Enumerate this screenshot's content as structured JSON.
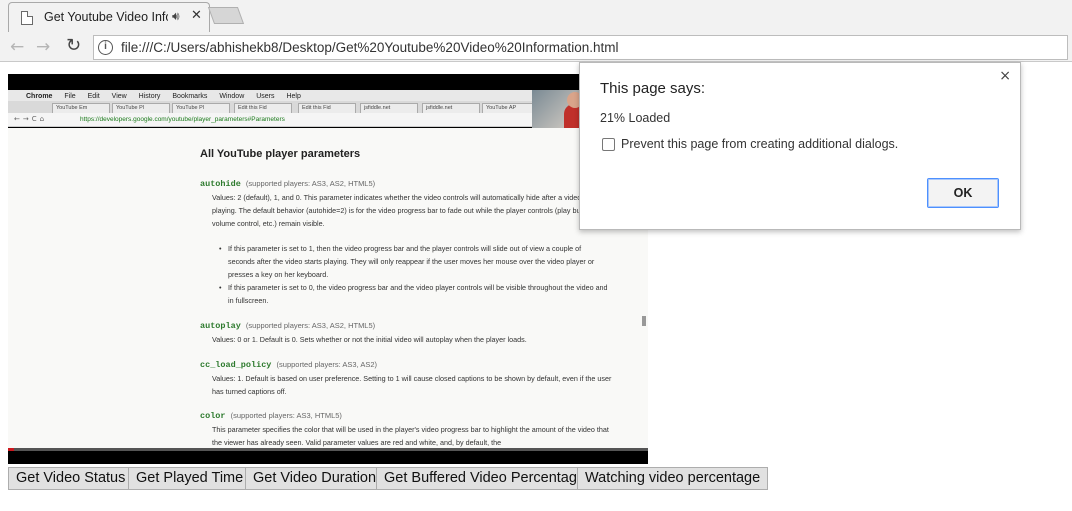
{
  "browser": {
    "tab_title": "Get Youtube Video Information",
    "tab_audio_icon": "speaker-icon",
    "url": "file:///C:/Users/abhishekb8/Desktop/Get%20Youtube%20Video%20Information.html"
  },
  "video": {
    "menubar": [
      "Chrome",
      "File",
      "Edit",
      "View",
      "History",
      "Bookmarks",
      "Window",
      "Users",
      "Help"
    ],
    "tabs": [
      "YouTube Em",
      "YouTube Pl",
      "YouTube Pl",
      "Edit this Fid",
      "Edit this Fid",
      "jsfiddle.net",
      "jsfiddle.net",
      "YouTube AP"
    ],
    "address": "https://developers.google.com/youtube/player_parameters#Parameters",
    "heading": "All YouTube player parameters",
    "params": [
      {
        "name": "autohide",
        "supported": "(supported players: AS3, AS2, HTML5)",
        "text": "Values: 2 (default), 1, and 0. This parameter indicates whether the video controls will automatically hide after a video begins playing. The default behavior (autohide=2) is for the video progress bar to fade out while the player controls (play button, volume control, etc.) remain visible."
      },
      {
        "name": "autoplay",
        "supported": "(supported players: AS3, AS2, HTML5)",
        "text": "Values: 0 or 1. Default is 0. Sets whether or not the initial video will autoplay when the player loads."
      },
      {
        "name": "cc_load_policy",
        "supported": "(supported players: AS3, AS2)",
        "text": "Values: 1. Default is based on user preference. Setting to 1 will cause closed captions to be shown by default, even if the user has turned captions off."
      },
      {
        "name": "color",
        "supported": "(supported players: AS3, HTML5)",
        "text": "This parameter specifies the color that will be used in the player's video progress bar to highlight the amount of the video that the viewer has already seen. Valid parameter values are red and white, and, by default, the"
      }
    ],
    "bullets": [
      "If this parameter is set to 1, then the video progress bar and the player controls will slide out of view a couple of seconds after the video starts playing. They will only reappear if the user moves her mouse over the video player or presses a key on her keyboard.",
      "If this parameter is set to 0, the video progress bar and the video player controls will be visible throughout the video and in fullscreen."
    ],
    "progress_fraction": 0.01
  },
  "buttons": [
    "Get Video Status",
    "Get Played Time",
    "Get Video Duration",
    "Get Buffered Video Percentage",
    "Watching video percentage"
  ],
  "dialog": {
    "title": "This page says:",
    "message": "21% Loaded",
    "checkbox_label": "Prevent this page from creating additional dialogs.",
    "ok_label": "OK",
    "close_glyph": "×"
  },
  "colors": {
    "dialog_ok_border": "#4d90fe",
    "param_color": "#2d7a2d",
    "progress_color": "#cc181e"
  }
}
